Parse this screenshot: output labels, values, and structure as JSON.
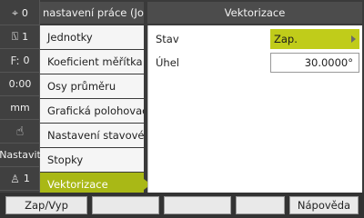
{
  "status": [
    {
      "icon": "axis-target-icon",
      "glyph": "⌖",
      "value": "0"
    },
    {
      "icon": "tool-icon",
      "glyph": "⍂",
      "value": "1"
    },
    {
      "icon": "feed-icon",
      "glyph": "F:",
      "value": "0"
    },
    {
      "icon": "timer-icon",
      "glyph": "",
      "value": "0:00"
    },
    {
      "icon": "unit-icon",
      "glyph": "",
      "value": "mm"
    },
    {
      "icon": "hand-icon",
      "glyph": "☝",
      "value": ""
    },
    {
      "icon": "setup-icon",
      "glyph": "",
      "value": "Nastavit"
    },
    {
      "icon": "user-icon",
      "glyph": "♙",
      "value": "1"
    }
  ],
  "left_header": "nastavení práce (Job Setu",
  "right_header": "Vektorizace",
  "menu": [
    {
      "label": "Jednotky"
    },
    {
      "label": "Koeficient měřítka"
    },
    {
      "label": "Osy průměru"
    },
    {
      "label": "Grafická polohovací po"
    },
    {
      "label": "Nastavení stavového p"
    },
    {
      "label": "Stopky"
    },
    {
      "label": "Vektorizace"
    }
  ],
  "active_menu_index": 6,
  "properties": {
    "state_label": "Stav",
    "state_value": "Zap.",
    "angle_label": "Úhel",
    "angle_value": "30.0000°"
  },
  "buttons": {
    "toggle": "Zap/Vyp",
    "help": "Nápověda"
  },
  "colors": {
    "accent": "#a9b816",
    "select": "#c0cc1a"
  }
}
